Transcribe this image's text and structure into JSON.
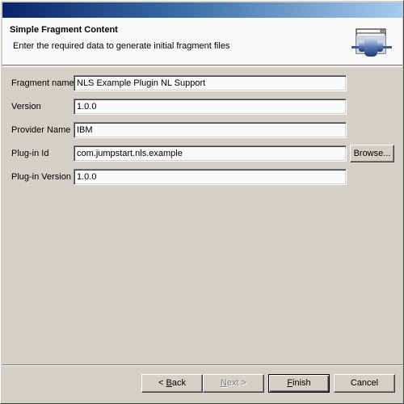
{
  "header": {
    "title": "Simple Fragment Content",
    "description": "Enter the required data to generate initial fragment files",
    "icon": "plugin-fragment-wizard-icon"
  },
  "form": {
    "fields": [
      {
        "label": "Fragment name",
        "value": "NLS Example Plugin NL Support"
      },
      {
        "label": "Version",
        "value": "1.0.0"
      },
      {
        "label": "Provider Name",
        "value": "IBM"
      },
      {
        "label": "Plug-in Id",
        "value": "com.jumpstart.nls.example"
      },
      {
        "label": "Plug-in Version",
        "value": "1.0.0"
      }
    ],
    "browse_label": "Browse..."
  },
  "footer": {
    "back": {
      "prefix": "< ",
      "mnemonic": "B",
      "rest": "ack"
    },
    "next": {
      "mnemonic": "N",
      "rest": "ext >"
    },
    "finish": {
      "mnemonic": "F",
      "rest": "inish"
    },
    "cancel": "Cancel"
  }
}
